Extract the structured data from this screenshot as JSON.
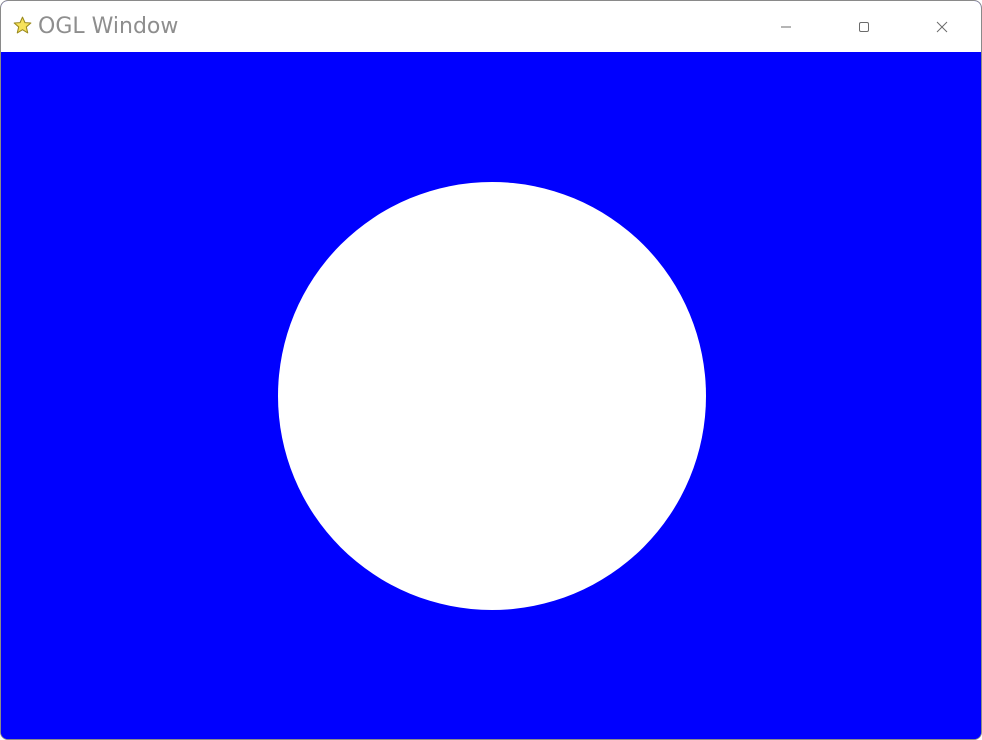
{
  "window": {
    "title": "OGL Window",
    "icon": "star-icon",
    "controls": {
      "minimize_icon": "minimize-icon",
      "maximize_icon": "maximize-icon",
      "close_icon": "close-icon"
    }
  },
  "scene": {
    "background_color": "#0000ff",
    "shape": "circle",
    "shape_color": "#ffffff"
  }
}
